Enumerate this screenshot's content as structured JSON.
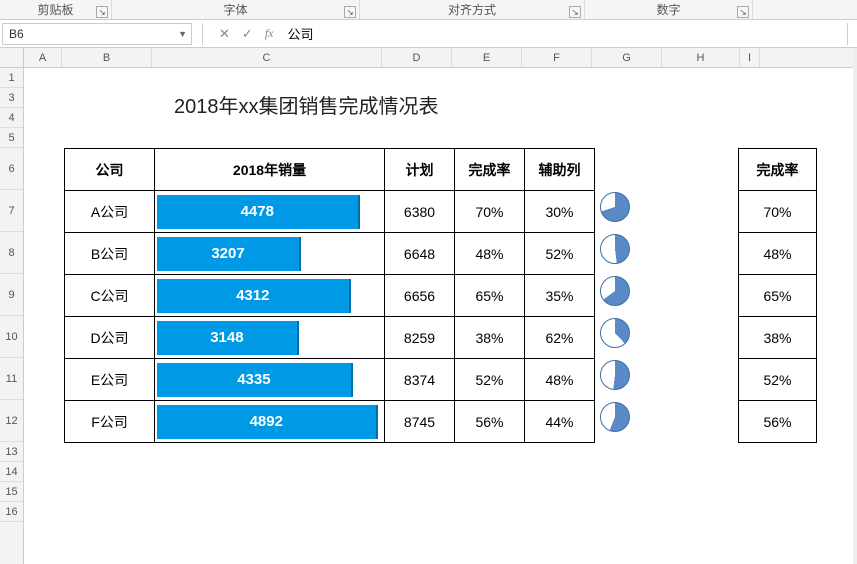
{
  "ribbon": {
    "groups": [
      "剪贴板",
      "字体",
      "对齐方式",
      "数字"
    ],
    "widths": [
      112,
      248,
      225,
      168
    ]
  },
  "namebox": {
    "cell": "B6"
  },
  "formula_bar": {
    "fx": "fx",
    "value": "公司",
    "cancel": "✕",
    "confirm": "✓"
  },
  "columns": {
    "labels": [
      "A",
      "B",
      "C",
      "D",
      "E",
      "F",
      "G",
      "H",
      "I"
    ],
    "widths": [
      38,
      90,
      230,
      70,
      70,
      70,
      70,
      78,
      20
    ]
  },
  "rows": {
    "short": [
      "1",
      "3",
      "4",
      "5"
    ],
    "tall": [
      "6",
      "7",
      "8",
      "9",
      "10",
      "11",
      "12"
    ],
    "trailing": [
      "13",
      "14",
      "15",
      "16"
    ]
  },
  "title": "2018年xx集团销售完成情况表",
  "headers": {
    "company": "公司",
    "sales": "2018年销量",
    "plan": "计划",
    "rate": "完成率",
    "aux": "辅助列",
    "rate2": "完成率"
  },
  "data": [
    {
      "company": "A公司",
      "sales": 4478,
      "plan": 6380,
      "rate": "70%",
      "aux": "30%",
      "pct": 70,
      "barpct": 90
    },
    {
      "company": "B公司",
      "sales": 3207,
      "plan": 6648,
      "rate": "48%",
      "aux": "52%",
      "pct": 48,
      "barpct": 64
    },
    {
      "company": "C公司",
      "sales": 4312,
      "plan": 6656,
      "rate": "65%",
      "aux": "35%",
      "pct": 65,
      "barpct": 86
    },
    {
      "company": "D公司",
      "sales": 3148,
      "plan": 8259,
      "rate": "38%",
      "aux": "62%",
      "pct": 38,
      "barpct": 63
    },
    {
      "company": "E公司",
      "sales": 4335,
      "plan": 8374,
      "rate": "52%",
      "aux": "48%",
      "pct": 52,
      "barpct": 87
    },
    {
      "company": "F公司",
      "sales": 4892,
      "plan": 8745,
      "rate": "56%",
      "aux": "44%",
      "pct": 56,
      "barpct": 98
    }
  ],
  "colors": {
    "bar": "#0099e5",
    "pie_fill": "#5a8ac6",
    "pie_empty": "#ffffff"
  }
}
